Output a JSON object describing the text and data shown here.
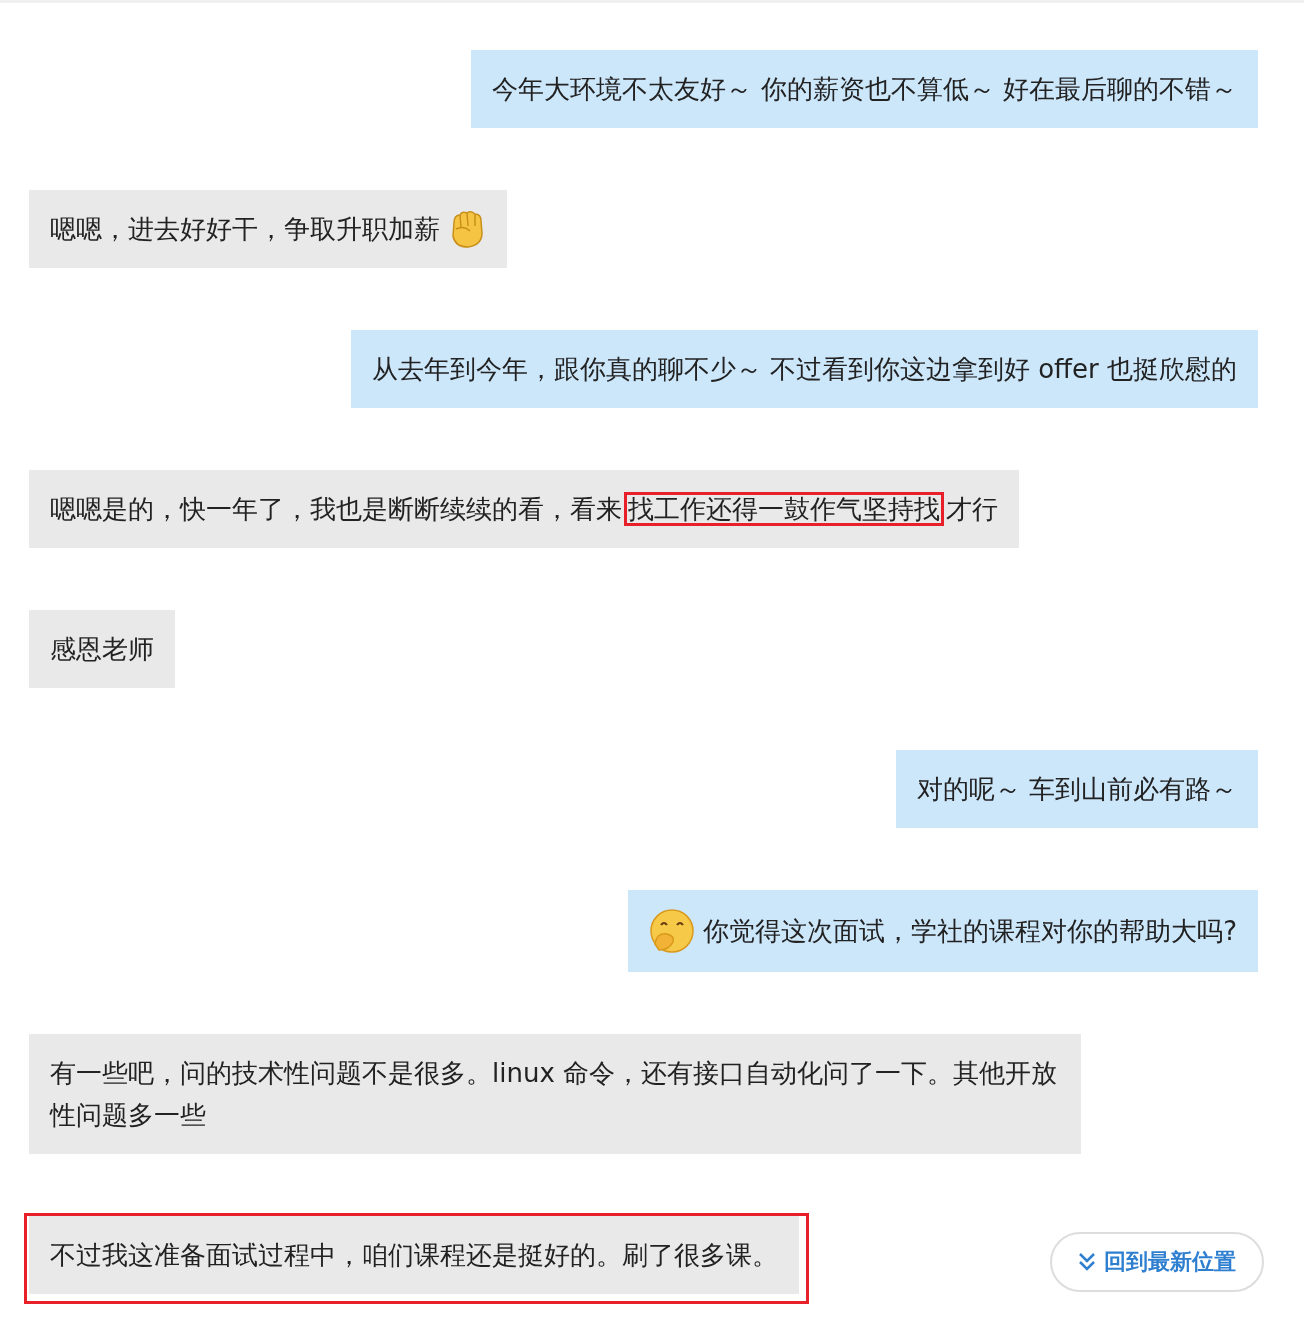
{
  "messages": [
    {
      "kind": "sent",
      "parts": [
        {
          "kind": "text",
          "text": "今年大环境不太友好～  你的薪资也不算低～ 好在最后聊的不错～",
          "marked": false
        }
      ]
    },
    {
      "kind": "received",
      "parts": [
        {
          "kind": "text",
          "text": "嗯嗯，进去好好干，争取升职加薪",
          "marked": false
        },
        {
          "kind": "fist"
        }
      ]
    },
    {
      "kind": "sent",
      "parts": [
        {
          "kind": "text",
          "text": "从去年到今年，跟你真的聊不少～ 不过看到你这边拿到好 offer 也挺欣慰的",
          "marked": false
        }
      ]
    },
    {
      "kind": "received",
      "parts": [
        {
          "kind": "text",
          "text": "嗯嗯是的，快一年了，我也是断断续续的看，看来",
          "marked": false
        },
        {
          "kind": "text",
          "text": "找工作还得一鼓作气坚持找",
          "marked": true
        },
        {
          "kind": "text",
          "text": "才行",
          "marked": false
        }
      ]
    },
    {
      "kind": "received",
      "parts": [
        {
          "kind": "text",
          "text": "感恩老师",
          "marked": false
        }
      ]
    },
    {
      "kind": "sent",
      "parts": [
        {
          "kind": "text",
          "text": "对的呢～  车到山前必有路～",
          "marked": false
        }
      ]
    },
    {
      "kind": "sent",
      "parts": [
        {
          "kind": "giggle"
        },
        {
          "kind": "text",
          "text": "你觉得这次面试，学社的课程对你的帮助大吗?",
          "marked": false
        }
      ]
    },
    {
      "kind": "received",
      "parts": [
        {
          "kind": "text",
          "text": "有一些吧，问的技术性问题不是很多。linux 命令，还有接口自动化问了一下。其他开放性问题多一些",
          "marked": false
        }
      ]
    },
    {
      "kind": "received",
      "parts": [
        {
          "kind": "text",
          "text": "不过我这准备面试过程中，咱们课程还是挺好的。刷了很多课。",
          "marked": false
        }
      ],
      "annotated": true
    }
  ],
  "scroll_button": {
    "label": "回到最新位置"
  }
}
